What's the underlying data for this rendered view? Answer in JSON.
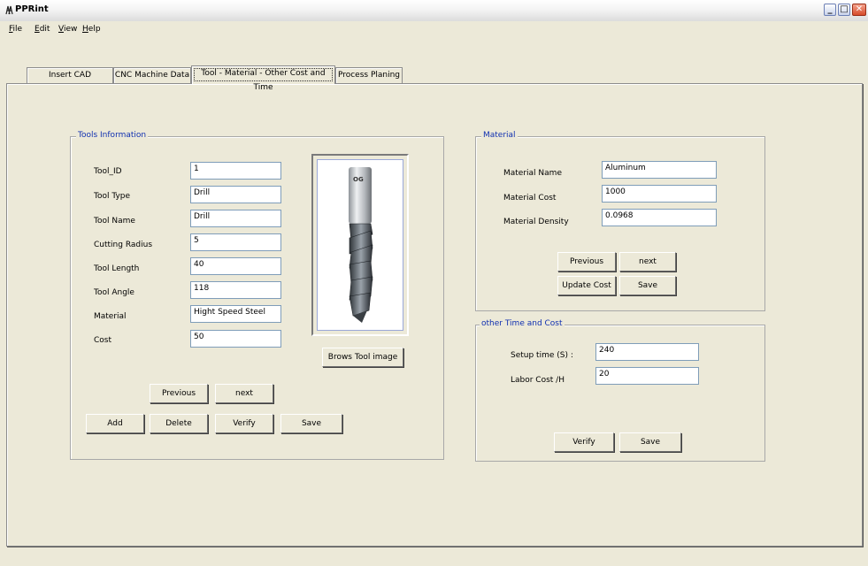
{
  "window": {
    "title": "PPRint"
  },
  "menu": {
    "file": "ile",
    "file_key": "F",
    "edit": "dit",
    "edit_key": "E",
    "view": "iew",
    "view_key": "V",
    "help": "elp",
    "help_key": "H"
  },
  "tabs": [
    {
      "label": "Insert CAD information"
    },
    {
      "label": "CNC Machine Data"
    },
    {
      "label": "Tool - Material - Other Cost and Time"
    },
    {
      "label": "Process Planing"
    }
  ],
  "tools": {
    "legend": "Tools Information",
    "fields": [
      {
        "label": "Tool_ID",
        "value": "1"
      },
      {
        "label": "Tool Type",
        "value": "Drill"
      },
      {
        "label": "Tool Name",
        "value": "Drill"
      },
      {
        "label": "Cutting Radius",
        "value": "5"
      },
      {
        "label": "Tool Length",
        "value": "40"
      },
      {
        "label": "Tool Angle",
        "value": "118"
      },
      {
        "label": "Material",
        "value": "Hight Speed Steel"
      },
      {
        "label": "Cost",
        "value": "50"
      }
    ],
    "image_logo": "OG",
    "browse_label": "Brows Tool image",
    "previous_label": "Previous",
    "next_label": "next",
    "add_label": "Add",
    "delete_label": "Delete",
    "verify_label": "Verify",
    "save_label": "Save"
  },
  "material": {
    "legend": "Material",
    "fields": [
      {
        "label": "Material Name",
        "value": "Aluminum"
      },
      {
        "label": "Material Cost",
        "value": "1000"
      },
      {
        "label": "Material Density",
        "value": "0.0968"
      }
    ],
    "previous_label": "Previous",
    "next_label": "next",
    "update_label": "Update Cost",
    "save_label": "Save"
  },
  "other": {
    "legend": "other Time and Cost",
    "fields": [
      {
        "label": "Setup time (S) :",
        "value": "240"
      },
      {
        "label": "Labor Cost /H",
        "value": "20"
      }
    ],
    "verify_label": "Verify",
    "save_label": "Save"
  },
  "colors": {
    "legend": "#1030b0",
    "background": "#ece9d8"
  }
}
